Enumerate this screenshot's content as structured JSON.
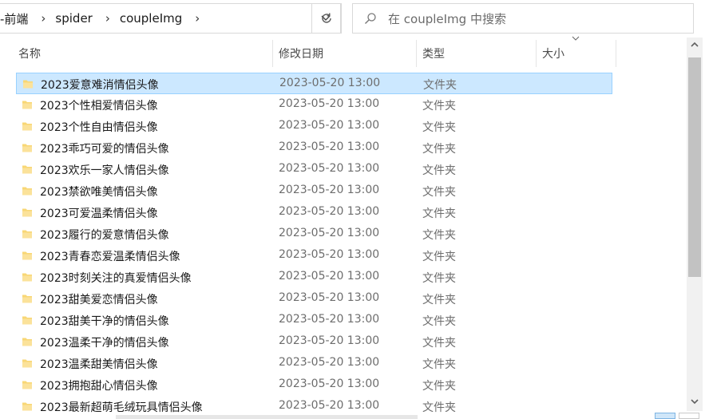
{
  "address": {
    "crumbs": [
      "-前端",
      "spider",
      "coupleImg"
    ]
  },
  "search": {
    "placeholder": "在 coupleImg 中搜索"
  },
  "columns": {
    "name": "名称",
    "modified": "修改日期",
    "type": "类型",
    "size": "大小"
  },
  "files": [
    {
      "name": "2023爱意难消情侣头像",
      "date": "2023-05-20 13:00",
      "type": "文件夹",
      "selected": true
    },
    {
      "name": "2023个性相爱情侣头像",
      "date": "2023-05-20 13:00",
      "type": "文件夹"
    },
    {
      "name": "2023个性自由情侣头像",
      "date": "2023-05-20 13:00",
      "type": "文件夹"
    },
    {
      "name": "2023乖巧可爱的情侣头像",
      "date": "2023-05-20 13:00",
      "type": "文件夹"
    },
    {
      "name": "2023欢乐一家人情侣头像",
      "date": "2023-05-20 13:00",
      "type": "文件夹"
    },
    {
      "name": "2023禁欲唯美情侣头像",
      "date": "2023-05-20 13:00",
      "type": "文件夹"
    },
    {
      "name": "2023可爱温柔情侣头像",
      "date": "2023-05-20 13:00",
      "type": "文件夹"
    },
    {
      "name": "2023履行的爱意情侣头像",
      "date": "2023-05-20 13:00",
      "type": "文件夹"
    },
    {
      "name": "2023青春恋爱温柔情侣头像",
      "date": "2023-05-20 13:00",
      "type": "文件夹"
    },
    {
      "name": "2023时刻关注的真爱情侣头像",
      "date": "2023-05-20 13:00",
      "type": "文件夹"
    },
    {
      "name": "2023甜美爱恋情侣头像",
      "date": "2023-05-20 13:00",
      "type": "文件夹"
    },
    {
      "name": "2023甜美干净的情侣头像",
      "date": "2023-05-20 13:00",
      "type": "文件夹"
    },
    {
      "name": "2023温柔干净的情侣头像",
      "date": "2023-05-20 13:00",
      "type": "文件夹"
    },
    {
      "name": "2023温柔甜美情侣头像",
      "date": "2023-05-20 13:00",
      "type": "文件夹"
    },
    {
      "name": "2023拥抱甜心情侣头像",
      "date": "2023-05-20 13:00",
      "type": "文件夹"
    },
    {
      "name": "2023最新超萌毛绒玩具情侣头像",
      "date": "2023-05-20 13:00",
      "type": "文件夹"
    }
  ],
  "icons": {
    "folder": "folder-icon",
    "refresh": "refresh-icon",
    "search": "search-icon",
    "dropdown": "chevron-down-icon"
  },
  "colors": {
    "selection": "#cce8ff",
    "selection_border": "#99d1ff",
    "folder": "#f8d775"
  }
}
